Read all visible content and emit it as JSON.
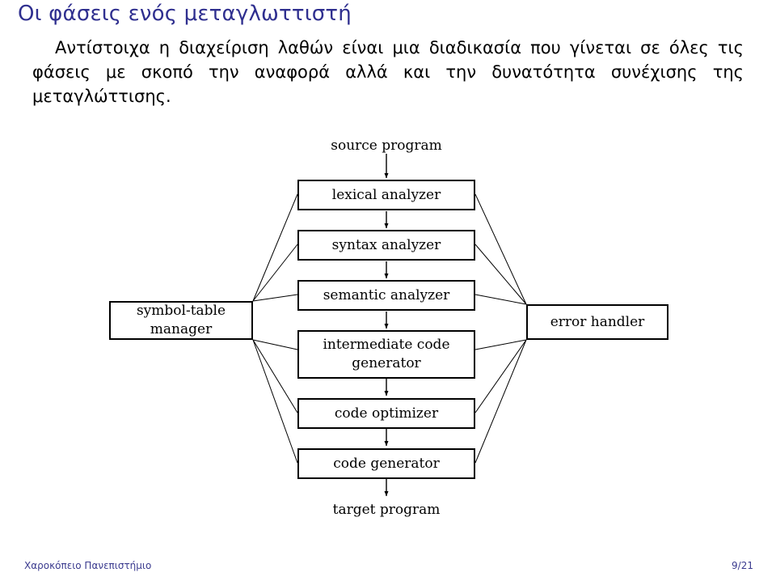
{
  "slide": {
    "title": "Οι φάσεις ενός μεταγλωττιστή",
    "body": "Αντίστοιχα η διαχείριση λαθών είναι μια διαδικασία που γίνεται σε όλες τις φάσεις με σκοπό την αναφορά αλλά και την δυνατότητα συνέχισης της μεταγλώττισης.",
    "title_color": "#2f2f8f",
    "body_color": "#000000",
    "background": "#ffffff"
  },
  "diagram": {
    "type": "flowchart",
    "line_color": "#000000",
    "box_border_color": "#000000",
    "box_fill": "#ffffff",
    "input_label": "source program",
    "output_label": "target program",
    "pipeline": [
      {
        "id": "lexical",
        "label": "lexical analyzer"
      },
      {
        "id": "syntax",
        "label": "syntax analyzer"
      },
      {
        "id": "semantic",
        "label": "semantic analyzer"
      },
      {
        "id": "intermediate",
        "label": "intermediate code generator"
      },
      {
        "id": "optimizer",
        "label": "code optimizer"
      },
      {
        "id": "generator",
        "label": "code generator"
      }
    ],
    "side_left": {
      "id": "symbol-table",
      "label": "symbol-table manager"
    },
    "side_right": {
      "id": "error-handler",
      "label": "error handler"
    }
  },
  "footer": {
    "institution": "Χαροκόπειο Πανεπιστήμιο",
    "page": "9/21",
    "color": "#3b3b8f"
  }
}
